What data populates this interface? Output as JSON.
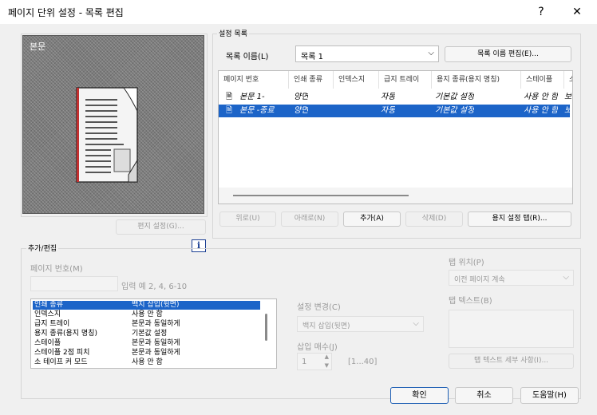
{
  "window": {
    "title": "페이지 단위 설정 - 목록 편집",
    "help": "?",
    "close": "✕"
  },
  "preview": {
    "label": "본문"
  },
  "edit_settings_button": "편지 설정(G)...",
  "settings_list": {
    "group_label": "설정 목록",
    "list_name_label": "목록 이름(L)",
    "list_name_value": "목록 1",
    "edit_name_button": "목록 이름 편집(E)...",
    "columns": [
      "페이지 번호",
      "인쇄 종류",
      "인덱스지",
      "급지 트레이",
      "용지 종류(용지 명칭)",
      "스테이플",
      "소"
    ],
    "rows": [
      {
        "cells": [
          "본문 1-",
          "양면",
          "",
          "자동",
          "기본값 설정",
          "사용 안 함",
          "보"
        ],
        "selected": false
      },
      {
        "cells": [
          "본문 -종료",
          "양면",
          "",
          "자동",
          "기본값 설정",
          "사용 안 함",
          "보"
        ],
        "selected": true
      }
    ]
  },
  "list_buttons": {
    "up": "위로(U)",
    "down": "아래로(N)",
    "add": "추가(A)",
    "delete": "삭제(D)",
    "tab_settings": "용지 설정 탭(R)..."
  },
  "info_icon": "i",
  "add_edit": {
    "group_label": "추가/편집",
    "page_number_label": "페이지 번호(M)",
    "page_number_value": "",
    "page_number_hint": "입력 예 2, 4, 6-10",
    "items": [
      {
        "name": "인쇄 종류",
        "value": "백지 삽입(뒷면)",
        "selected": true
      },
      {
        "name": "인덱스지",
        "value": "사용 안 함",
        "selected": false
      },
      {
        "name": "급지 트레이",
        "value": "본문과 동일하게",
        "selected": false
      },
      {
        "name": "용지 종류(용지 명칭)",
        "value": "기본값 설정",
        "selected": false
      },
      {
        "name": "스테이플",
        "value": "본문과 동일하게",
        "selected": false
      },
      {
        "name": "스테이플 2점 피치",
        "value": "본문과 동일하게",
        "selected": false
      },
      {
        "name": "소 테이프 커 모드",
        "value": "사용 안 함",
        "selected": false
      }
    ],
    "setting_change_label": "설정 변경(C)",
    "setting_change_value": "백지 삽입(뒷면)",
    "insert_count_label": "삽입 매수(J)",
    "insert_count_value": "1",
    "insert_count_range": "[1...40]",
    "tab_position_label": "탭 위치(P)",
    "tab_position_value": "이전 페이지 계속",
    "tab_text_label": "탭 텍스트(B)",
    "tab_text_button": "탭 텍스트 세부 사항(I)..."
  },
  "footer": {
    "ok": "확인",
    "cancel": "취소",
    "help": "도움말(H)"
  },
  "colors": {
    "selection": "#1c64c8",
    "default_border": "#1e5fb4"
  }
}
